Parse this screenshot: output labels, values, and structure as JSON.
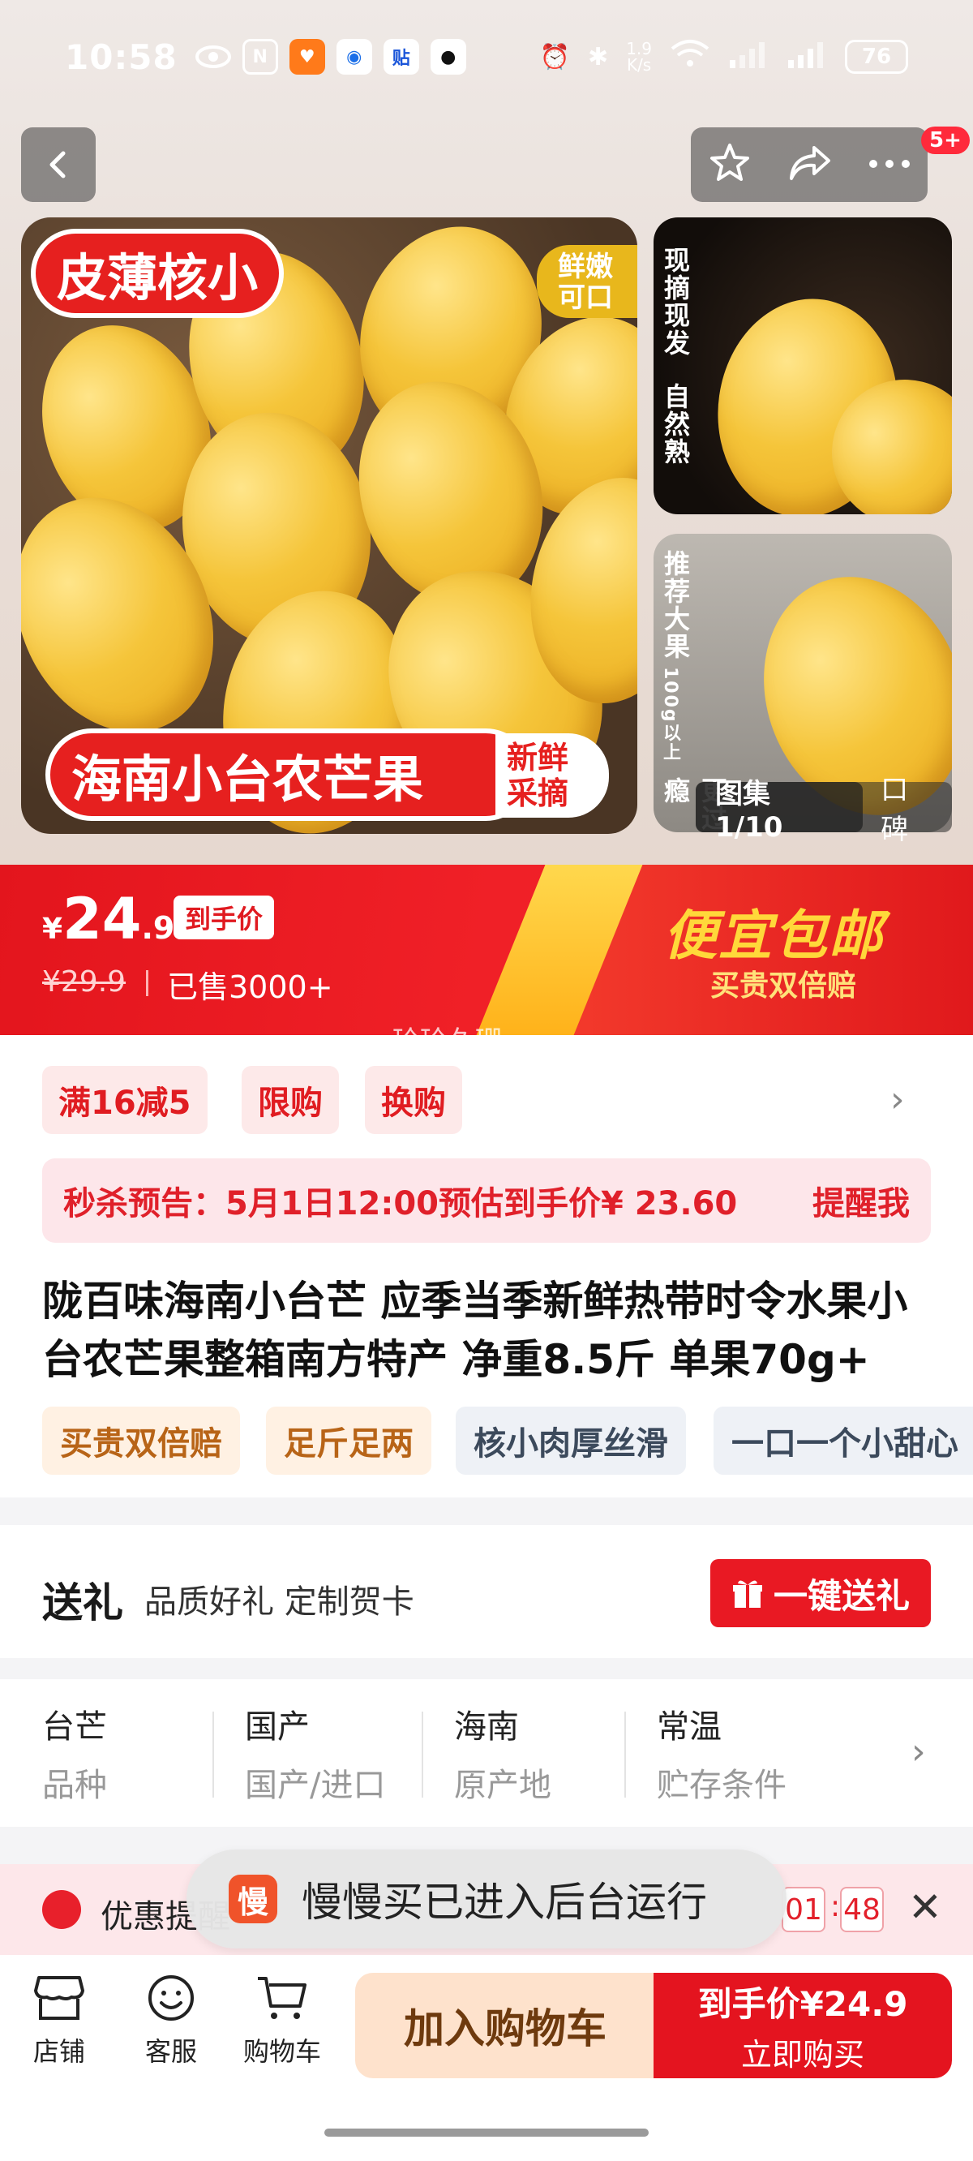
{
  "status_bar": {
    "time": "10:58",
    "net_speed": "1.9\nK/s",
    "battery": "76",
    "app_icons": [
      "eye-icon",
      "nfc-icon",
      "taobao-icon",
      "app-icon",
      "tie-icon",
      "qq-icon"
    ]
  },
  "nav": {
    "cart_badge": "5+"
  },
  "images": {
    "main_top_label": "皮薄核小",
    "main_corner_label": "鲜嫩\n可口",
    "main_bottom_label": "海南小台农芒果",
    "main_bottom_tag": "新鲜\n采摘",
    "side1_label_a": "现摘现发",
    "side1_label_b": "自然熟",
    "side2_label_a": "推荐大果",
    "side2_label_b": "100g以上",
    "side2_label_c": "更过瘾",
    "gallery": "图集 1/10",
    "reviews": "口碑"
  },
  "price": {
    "currency": "¥",
    "integer": "24",
    "decimal": ".9",
    "price_tag": "到手价",
    "original": "¥29.9",
    "sold": "已售3000+",
    "cheap_title": "便宜包邮",
    "cheap_sub": "买贵双倍赔",
    "watermark": "玲玲久珊"
  },
  "promos": [
    "满16减5",
    "限购",
    "换购"
  ],
  "flash_sale": {
    "text": "秒杀预告：5月1日12:00预估到手价¥ 23.60",
    "action": "提醒我"
  },
  "product": {
    "title": "陇百味海南小台芒 应季当季新鲜热带时令水果小台农芒果整箱南方特产 净重8.5斤 单果70g+",
    "tags": [
      {
        "label": "买贵双倍赔",
        "style": "orange"
      },
      {
        "label": "足斤足两",
        "style": "orange"
      },
      {
        "label": "核小肉厚丝滑",
        "style": "grey"
      },
      {
        "label": "一口一个小甜心",
        "style": "grey"
      }
    ]
  },
  "gift": {
    "title": "送礼",
    "subtitle": "品质好礼 定制贺卡",
    "button": "一键送礼"
  },
  "specs": [
    {
      "value": "台芒",
      "key": "品种"
    },
    {
      "value": "国产",
      "key": "国产/进口"
    },
    {
      "value": "海南",
      "key": "原产地"
    },
    {
      "value": "常温",
      "key": "贮存条件"
    }
  ],
  "countdown": {
    "label": "优惠提醒",
    "minutes": "01",
    "seconds": "48"
  },
  "toast": {
    "icon_text": "慢",
    "text": "慢慢买已进入后台运行"
  },
  "bottom": {
    "store": "店铺",
    "service": "客服",
    "cart": "购物车",
    "add_cart": "加入购物车",
    "buy_price": "到手价¥24.9",
    "buy_now": "立即购买"
  },
  "colors": {
    "accent_red": "#e4141f",
    "cheap_gold": "#ffd83a"
  }
}
